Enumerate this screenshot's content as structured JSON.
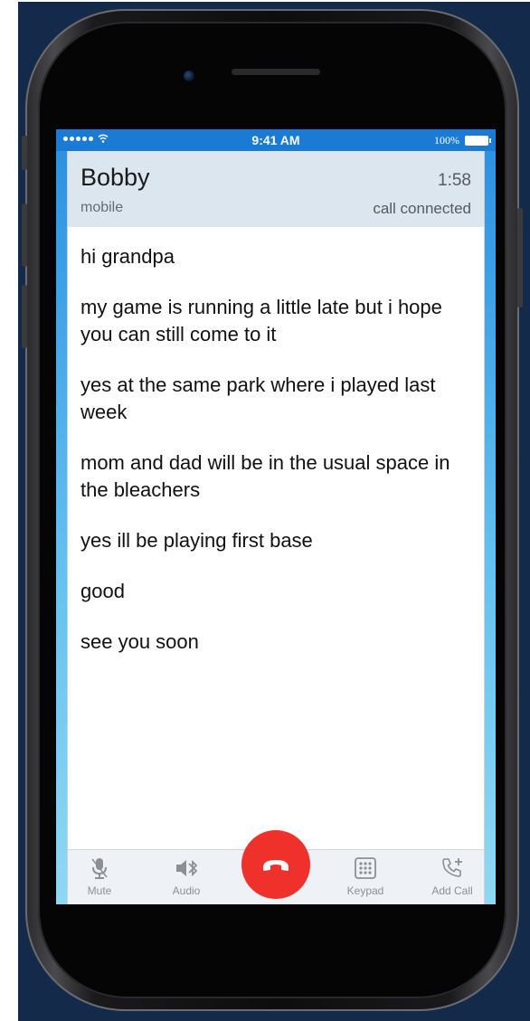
{
  "status_bar": {
    "time": "9:41 AM",
    "battery": "100%"
  },
  "call": {
    "caller_name": "Bobby",
    "duration": "1:58",
    "caller_type": "mobile",
    "status": "call connected"
  },
  "transcript": [
    "hi grandpa",
    "my game is running a little late but i hope you can still come to it",
    "yes at the same park where i played last week",
    "mom and dad will be in the usual space in the bleachers",
    "yes ill be playing first base",
    "good",
    "see you soon"
  ],
  "toolbar": {
    "mute_label": "Mute",
    "audio_label": "Audio",
    "keypad_label": "Keypad",
    "add_call_label": "Add Call",
    "mute_icon": "microphone-icon",
    "audio_icon": "bluetooth-speaker-icon",
    "end_call_icon": "phone-hangup-icon",
    "keypad_icon": "keypad-icon",
    "add_call_icon": "add-call-icon"
  },
  "colors": {
    "status_bar": "#1b7bd4",
    "header_bg": "#dce6ef",
    "end_call": "#f0302b",
    "toolbar_text": "#8a9096"
  }
}
